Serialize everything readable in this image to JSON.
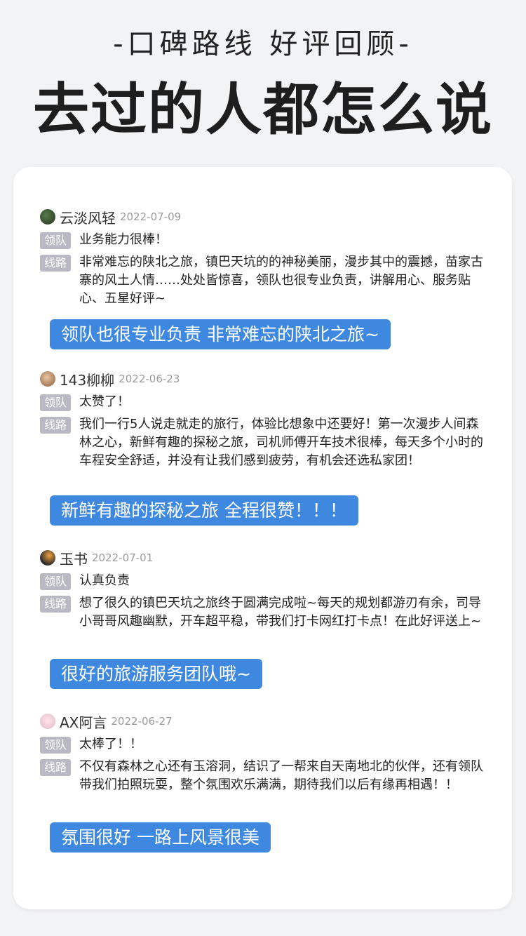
{
  "header": {
    "subtitle": "-口碑路线 好评回顾-",
    "title": "去过的人都怎么说"
  },
  "colors": {
    "accent": "#3e88df",
    "tag_bg": "#b9b9c3",
    "background": "#f2f3f5"
  },
  "tags": {
    "leader": "领队",
    "route": "线路"
  },
  "reviews": [
    {
      "username": "云淡风轻",
      "date": "2022-07-09",
      "leader_comment": "业务能力很棒！",
      "route_comment": "非常难忘的陕北之旅，镇巴天坑的的神秘美丽，漫步其中的震撼，苗家古寨的风土人情……处处皆惊喜，领队也很专业负责，讲解用心、服务贴心、五星好评~",
      "highlight": "领队也很专业负责 非常难忘的陕北之旅~"
    },
    {
      "username": "143柳柳",
      "date": "2022-06-23",
      "leader_comment": "太赞了！",
      "route_comment": "我们一行5人说走就走的旅行，体验比想象中还要好！第一次漫步人间森林之心，新鲜有趣的探秘之旅，司机师傅开车技术很棒，每天多个小时的车程安全舒适，并没有让我们感到疲劳，有机会还选私家团！",
      "highlight": "新鲜有趣的探秘之旅 全程很赞！！！"
    },
    {
      "username": "玉书",
      "date": "2022-07-01",
      "leader_comment": "认真负责",
      "route_comment": "想了很久的镇巴天坑之旅终于圆满完成啦~每天的规划都游刃有余，司导小哥哥风趣幽默，开车超平稳，带我们打卡网红打卡点！在此好评送上~",
      "highlight": "很好的旅游服务团队哦~"
    },
    {
      "username": "AX阿言",
      "date": "2022-06-27",
      "leader_comment": "太棒了！！",
      "route_comment": "不仅有森林之心还有玉溶洞，结识了一帮来自天南地北的伙伴，还有领队带我们拍照玩耍，整个氛围欢乐满满，期待我们以后有缘再相遇！！",
      "highlight": "氛围很好 一路上风景很美"
    }
  ]
}
